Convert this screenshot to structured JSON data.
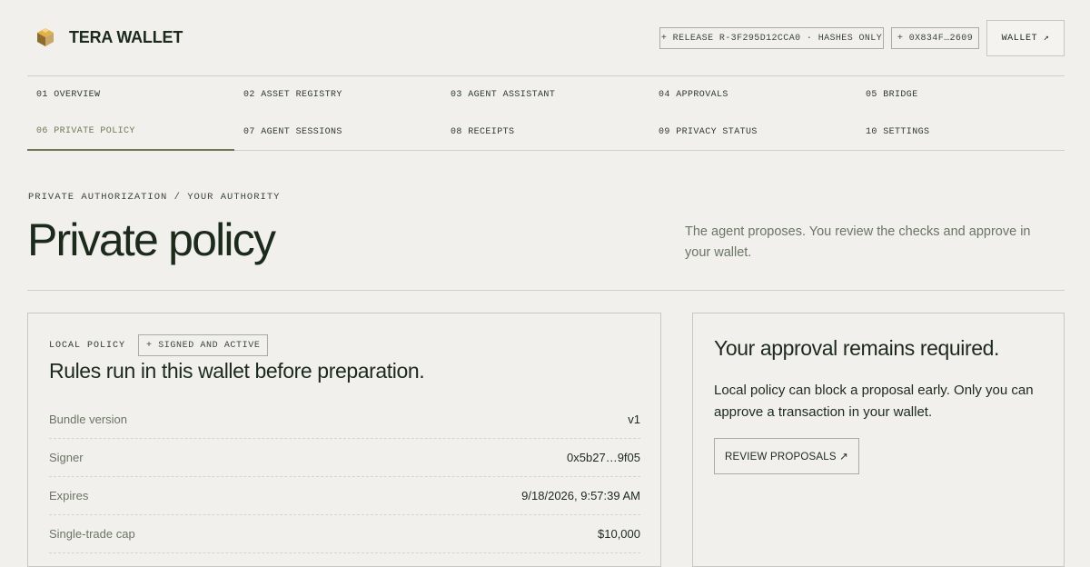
{
  "header": {
    "brand_name": "TERA WALLET",
    "logo_icon": "cube-logo-icon",
    "release_chip": "+ RELEASE R-3F295D12CCA0 · HASHES ONLY",
    "address_chip": "+ 0X834F…2609",
    "wallet_button": "WALLET ↗"
  },
  "nav": {
    "items": [
      {
        "label": "01 OVERVIEW"
      },
      {
        "label": "02 ASSET REGISTRY"
      },
      {
        "label": "03 AGENT ASSISTANT"
      },
      {
        "label": "04 APPROVALS"
      },
      {
        "label": "05 BRIDGE"
      },
      {
        "label": "06 PRIVATE POLICY",
        "active": true
      },
      {
        "label": "07 AGENT SESSIONS"
      },
      {
        "label": "08 RECEIPTS"
      },
      {
        "label": "09 PRIVACY STATUS"
      },
      {
        "label": "10 SETTINGS"
      }
    ]
  },
  "page": {
    "breadcrumb": "PRIVATE AUTHORIZATION / YOUR AUTHORITY",
    "title": "Private policy",
    "intro": "The agent proposes. You review the checks and approve in your wallet."
  },
  "policy_card": {
    "label": "LOCAL POLICY",
    "status": "+ SIGNED AND ACTIVE",
    "heading": "Rules run in this wallet before preparation.",
    "rows": [
      {
        "key": "Bundle version",
        "value": "v1"
      },
      {
        "key": "Signer",
        "value": "0x5b27…9f05"
      },
      {
        "key": "Expires",
        "value": "9/18/2026, 9:57:39 AM"
      },
      {
        "key": "Single-trade cap",
        "value": "$10,000"
      }
    ]
  },
  "approval_card": {
    "title": "Your approval remains required.",
    "text": "Local policy can block a proposal early. Only you can approve a transaction in your wallet.",
    "button": "REVIEW PROPOSALS ↗"
  },
  "colors": {
    "background": "#f1f0ed",
    "text": "#1c2a1c",
    "muted": "#6a7563",
    "accent": "#6d7a55",
    "border": "#cfd0c8"
  }
}
